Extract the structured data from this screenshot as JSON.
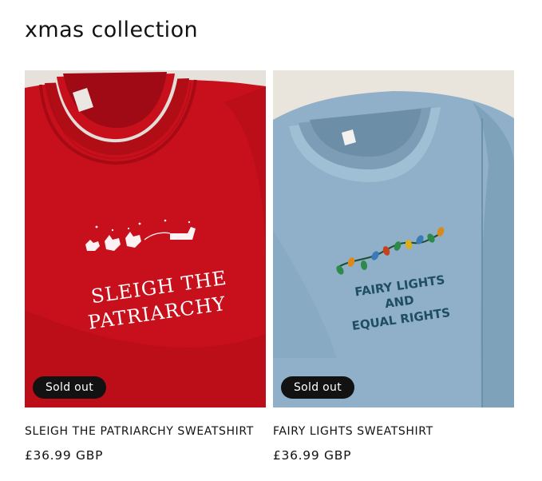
{
  "collection": {
    "title": "xmas collection"
  },
  "products": [
    {
      "title": "SLEIGH THE PATRIARCHY SWEATSHIRT",
      "price": "£36.99 GBP",
      "badge": "Sold out",
      "image": {
        "color": "#c8101c",
        "embroidery_line1": "SLEIGH THE",
        "embroidery_line2": "PATRIARCHY"
      }
    },
    {
      "title": "FAIRY LIGHTS SWEATSHIRT",
      "price": "£36.99 GBP",
      "badge": "Sold out",
      "image": {
        "color": "#8fb0c8",
        "embroidery_line1": "FAIRY LIGHTS",
        "embroidery_line2": "AND",
        "embroidery_line3": "EQUAL RIGHTS"
      }
    }
  ]
}
